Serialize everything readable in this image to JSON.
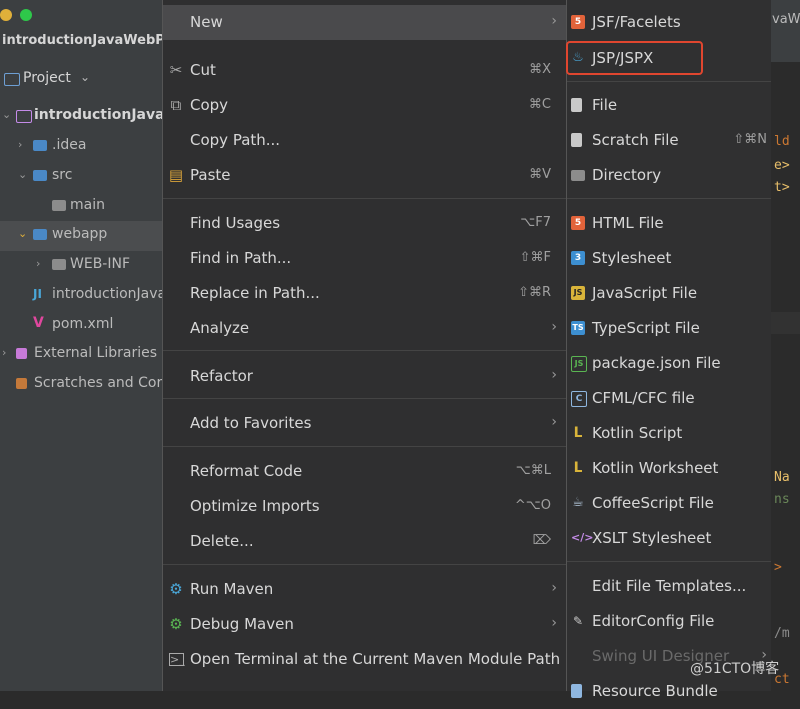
{
  "window": {
    "title": "introductionJavaWebPro"
  },
  "project_panel": {
    "header": "Project",
    "tree": [
      {
        "label": "introductionJavaW",
        "icon": "folder-icon",
        "bold": true
      },
      {
        "label": ".idea",
        "icon": "folder-icon"
      },
      {
        "label": "src",
        "icon": "folder-icon"
      },
      {
        "label": "main",
        "icon": "folder-icon"
      },
      {
        "label": "webapp",
        "icon": "folder-icon"
      },
      {
        "label": "WEB-INF",
        "icon": "folder-icon"
      },
      {
        "label": "introductionJava",
        "icon": "iml-file-icon"
      },
      {
        "label": "pom.xml",
        "icon": "maven-icon"
      },
      {
        "label": "External Libraries",
        "icon": "library-icon"
      },
      {
        "label": "Scratches and Cor",
        "icon": "scratch-icon"
      }
    ]
  },
  "context_menu": {
    "items": [
      {
        "label": "New",
        "shortcut": "",
        "submenu": true,
        "icon": ""
      },
      {
        "label": "Cut",
        "shortcut": "⌘X",
        "icon": "scissors-icon"
      },
      {
        "label": "Copy",
        "shortcut": "⌘C",
        "icon": "copy-icon"
      },
      {
        "label": "Copy Path...",
        "shortcut": "",
        "icon": ""
      },
      {
        "label": "Paste",
        "shortcut": "⌘V",
        "icon": "clipboard-icon"
      },
      {
        "label": "Find Usages",
        "shortcut": "⌥F7",
        "icon": ""
      },
      {
        "label": "Find in Path...",
        "shortcut": "⇧⌘F",
        "icon": ""
      },
      {
        "label": "Replace in Path...",
        "shortcut": "⇧⌘R",
        "icon": ""
      },
      {
        "label": "Analyze",
        "shortcut": "",
        "submenu": true,
        "icon": ""
      },
      {
        "label": "Refactor",
        "shortcut": "",
        "submenu": true,
        "icon": ""
      },
      {
        "label": "Add to Favorites",
        "shortcut": "",
        "submenu": true,
        "icon": ""
      },
      {
        "label": "Reformat Code",
        "shortcut": "⌥⌘L",
        "icon": ""
      },
      {
        "label": "Optimize Imports",
        "shortcut": "^⌥O",
        "icon": ""
      },
      {
        "label": "Delete...",
        "shortcut": "⌦",
        "icon": ""
      },
      {
        "label": "Run Maven",
        "shortcut": "",
        "submenu": true,
        "icon": "gear-icon"
      },
      {
        "label": "Debug Maven",
        "shortcut": "",
        "submenu": true,
        "icon": "gear-icon"
      },
      {
        "label": "Open Terminal at the Current Maven Module Path",
        "shortcut": "",
        "icon": "terminal-icon"
      }
    ]
  },
  "new_submenu": {
    "items": [
      {
        "label": "JSF/Facelets",
        "icon": "html5-icon"
      },
      {
        "label": "JSP/JSPX",
        "icon": "java-cup-icon",
        "highlighted_box": true
      },
      {
        "label": "File",
        "icon": "file-icon"
      },
      {
        "label": "Scratch File",
        "shortcut": "⇧⌘N",
        "icon": "scratch-file-icon"
      },
      {
        "label": "Directory",
        "icon": "folder-icon"
      },
      {
        "label": "HTML File",
        "icon": "html5-icon"
      },
      {
        "label": "Stylesheet",
        "icon": "css3-icon"
      },
      {
        "label": "JavaScript File",
        "icon": "javascript-icon"
      },
      {
        "label": "TypeScript File",
        "icon": "typescript-icon"
      },
      {
        "label": "package.json File",
        "icon": "nodejs-icon"
      },
      {
        "label": "CFML/CFC file",
        "icon": "cfml-icon"
      },
      {
        "label": "Kotlin Script",
        "icon": "kotlin-icon"
      },
      {
        "label": "Kotlin Worksheet",
        "icon": "kotlin-icon"
      },
      {
        "label": "CoffeeScript File",
        "icon": "coffeescript-icon"
      },
      {
        "label": "XSLT Stylesheet",
        "icon": "xslt-icon"
      },
      {
        "label": "Edit File Templates...",
        "icon": ""
      },
      {
        "label": "EditorConfig File",
        "icon": "editorconfig-icon"
      },
      {
        "label": "Swing UI Designer",
        "icon": "",
        "disabled": true,
        "submenu": true
      },
      {
        "label": "Resource Bundle",
        "icon": "resource-bundle-icon"
      }
    ]
  },
  "editor_tab_fragment": "vaW",
  "editor_fragments": [
    "ld",
    "e>",
    "t>",
    "Na",
    "ns",
    ">",
    "/m",
    "ct"
  ],
  "watermark": "@51CTO博客",
  "colors": {
    "highlight_box": "#e0462f",
    "menu_bg": "#2f2f30",
    "ide_bg": "#3c3f41"
  }
}
